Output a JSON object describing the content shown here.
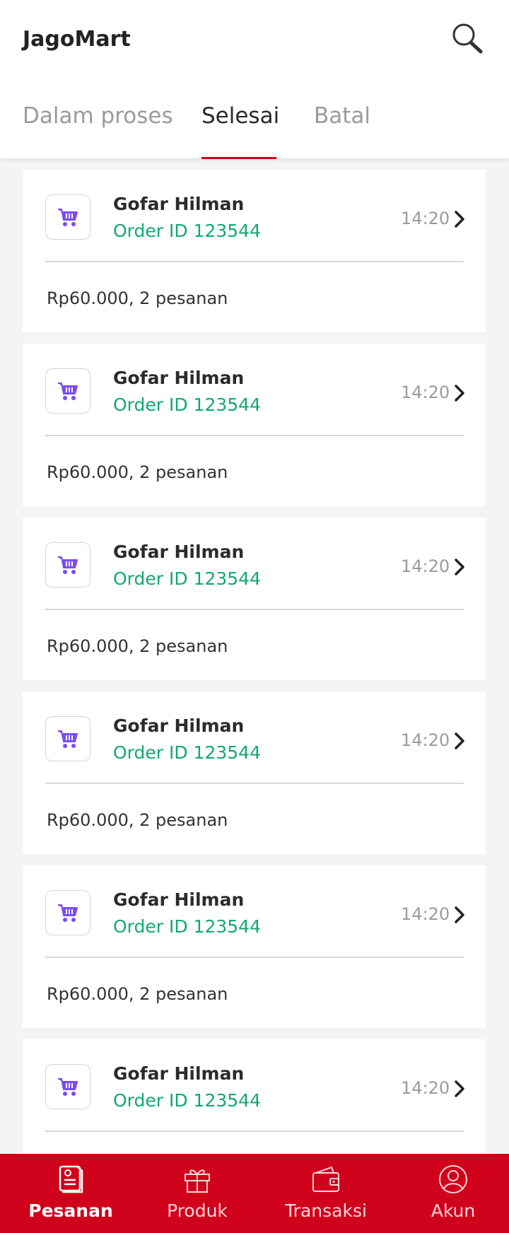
{
  "header": {
    "title": "JagoMart"
  },
  "tabs": [
    {
      "label": "Dalam proses",
      "active": false
    },
    {
      "label": "Selesai",
      "active": true
    },
    {
      "label": "Batal",
      "active": false
    }
  ],
  "orders": [
    {
      "name": "Gofar Hilman",
      "order_id": "Order ID 123544",
      "time": "14:20",
      "summary": "Rp60.000, 2 pesanan"
    },
    {
      "name": "Gofar Hilman",
      "order_id": "Order ID 123544",
      "time": "14:20",
      "summary": "Rp60.000, 2 pesanan"
    },
    {
      "name": "Gofar Hilman",
      "order_id": "Order ID 123544",
      "time": "14:20",
      "summary": "Rp60.000, 2 pesanan"
    },
    {
      "name": "Gofar Hilman",
      "order_id": "Order ID 123544",
      "time": "14:20",
      "summary": "Rp60.000, 2 pesanan"
    },
    {
      "name": "Gofar Hilman",
      "order_id": "Order ID 123544",
      "time": "14:20",
      "summary": "Rp60.000, 2 pesanan"
    },
    {
      "name": "Gofar Hilman",
      "order_id": "Order ID 123544",
      "time": "14:20",
      "summary": ""
    }
  ],
  "bottom_nav": [
    {
      "label": "Pesanan",
      "icon": "order-list-icon",
      "active": true
    },
    {
      "label": "Produk",
      "icon": "gift-icon",
      "active": false
    },
    {
      "label": "Transaksi",
      "icon": "wallet-icon",
      "active": false
    },
    {
      "label": "Akun",
      "icon": "user-icon",
      "active": false
    }
  ],
  "colors": {
    "brand_red": "#d0021b",
    "order_id_green": "#12a876",
    "cart_purple": "#7b4cf0"
  }
}
